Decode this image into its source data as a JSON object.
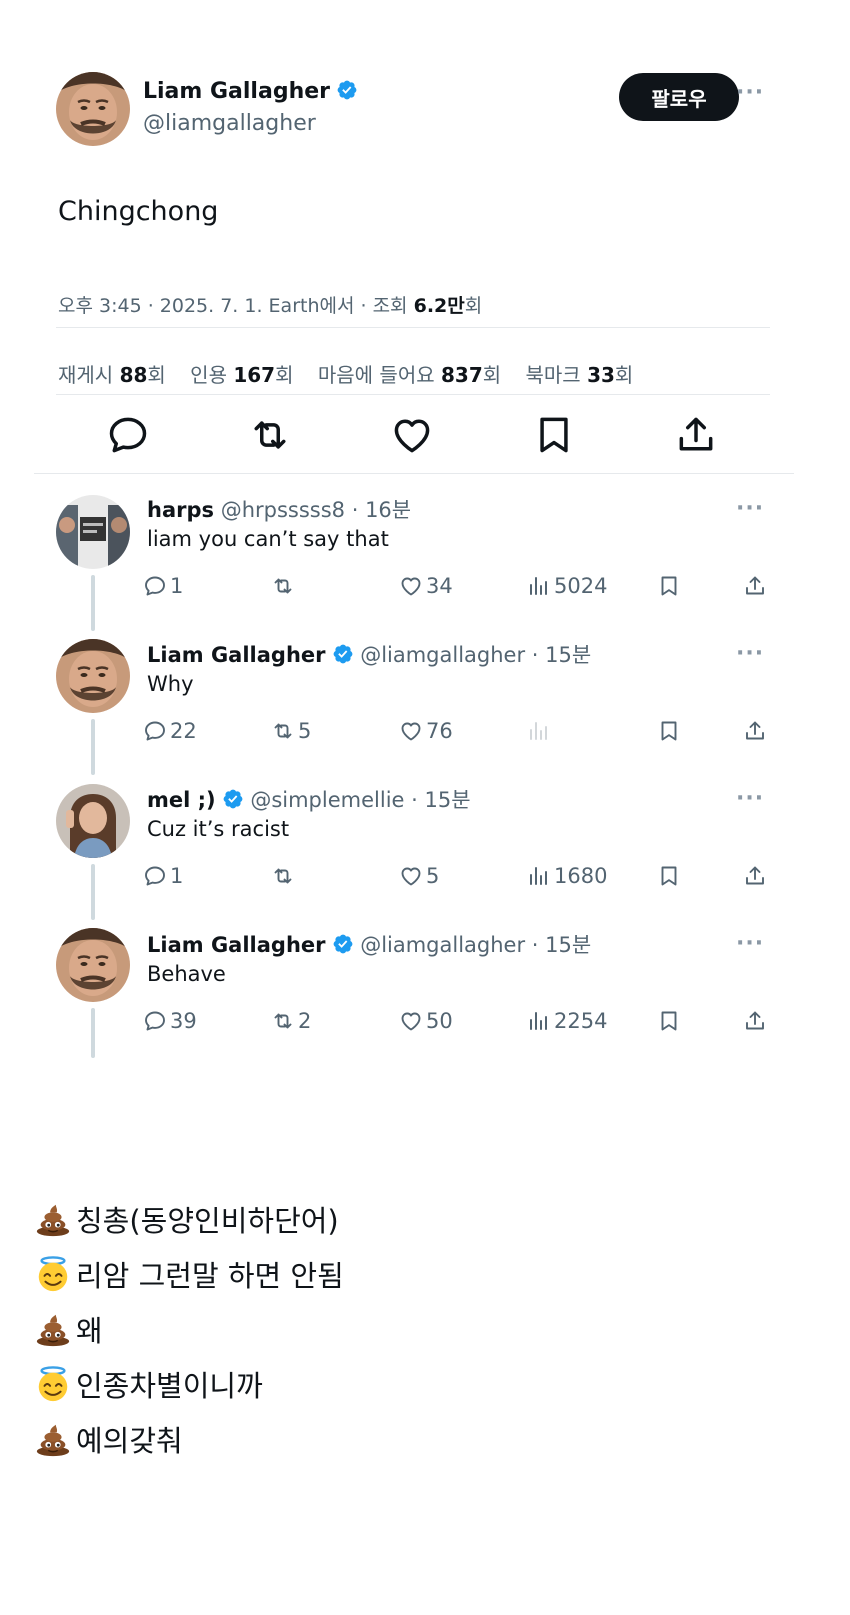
{
  "tweet": {
    "author": "Liam Gallagher",
    "handle": "@liamgallagher",
    "follow_label": "팔로우",
    "more": "···",
    "text": "Chingchong",
    "meta_prefix": "오후 3:45 · 2025. 7. 1. Earth에서 · 조회 ",
    "views": "6.2만",
    "views_suffix": "회",
    "stats": {
      "retweets_label": "재게시 ",
      "retweets": "88",
      "quotes_label": "인용 ",
      "quotes": "167",
      "likes_label": "마음에 들어요 ",
      "likes": "837",
      "bookmarks_label": "북마크 ",
      "bookmarks": "33",
      "unit": "회"
    }
  },
  "replies": [
    {
      "name": "harps",
      "handle": "@hrpsssss8 · 16분",
      "verified": false,
      "text": "liam you can’t say that",
      "replies": "1",
      "retweets": "",
      "likes": "34",
      "views": "5024"
    },
    {
      "name": "Liam Gallagher",
      "handle": "@liamgallagher · 15분",
      "verified": true,
      "text": "Why",
      "replies": "22",
      "retweets": "5",
      "likes": "76",
      "views": ""
    },
    {
      "name": "mel ;)",
      "handle": "@simplemellie · 15분",
      "verified": true,
      "text": "Cuz it’s racist",
      "replies": "1",
      "retweets": "",
      "likes": "5",
      "views": "1680"
    },
    {
      "name": "Liam Gallagher",
      "handle": "@liamgallagher · 15분",
      "verified": true,
      "text": "Behave",
      "replies": "39",
      "retweets": "2",
      "likes": "50",
      "views": "2254"
    }
  ],
  "captions": [
    {
      "emoji": "poop",
      "text": "칭총(동양인비하단어)"
    },
    {
      "emoji": "angel",
      "text": "리암 그런말 하면 안됨"
    },
    {
      "emoji": "poop",
      "text": "왜"
    },
    {
      "emoji": "angel",
      "text": "인종차별이니까"
    },
    {
      "emoji": "poop",
      "text": "예의갖춰"
    }
  ],
  "colors": {
    "verified": "#1d9bf0",
    "secondary_text": "#536471",
    "follow_bg": "#0f1419"
  }
}
